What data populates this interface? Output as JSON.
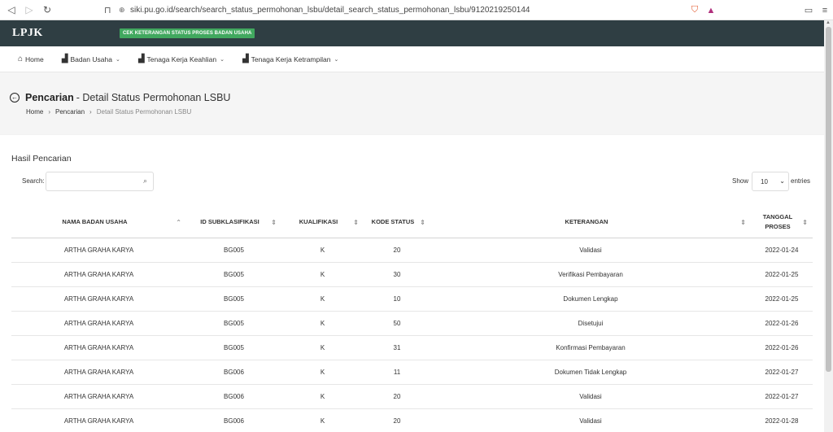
{
  "browser": {
    "url": "siki.pu.go.id/search/search_status_permohonan_lsbu/detail_search_status_permohonan_lsbu/9120219250144"
  },
  "header": {
    "logo": "LPJK",
    "badge": "CEK KETERANGAN STATUS PROSES BADAN USAHA"
  },
  "menu": {
    "items": [
      {
        "label": "Home",
        "icon": "home-icon",
        "dropdown": false
      },
      {
        "label": "Badan Usaha",
        "icon": "building-icon",
        "dropdown": true
      },
      {
        "label": "Tenaga Kerja Keahlian",
        "icon": "building-icon",
        "dropdown": true
      },
      {
        "label": "Tenaga Kerja Ketrampilan",
        "icon": "building-icon",
        "dropdown": true
      }
    ]
  },
  "page": {
    "title_main": "Pencarian",
    "title_sub": "- Detail Status Permohonan LSBU",
    "breadcrumb": [
      "Home",
      "Pencarian",
      "Detail Status Permohonan LSBU"
    ]
  },
  "card": {
    "title": "Hasil Pencarian",
    "search_label": "Search:",
    "search_value": "",
    "show_label": "Show",
    "entries_value": "10",
    "entries_label": "entries"
  },
  "table": {
    "columns": [
      "NAMA BADAN USAHA",
      "ID SUBKLASIFIKASI",
      "KUALIFIKASI",
      "KODE STATUS",
      "KETERANGAN",
      "TANGGAL PROSES"
    ],
    "rows": [
      [
        "ARTHA GRAHA KARYA",
        "BG005",
        "K",
        "20",
        "Validasi",
        "2022-01-24"
      ],
      [
        "ARTHA GRAHA KARYA",
        "BG005",
        "K",
        "30",
        "Verifikasi Pembayaran",
        "2022-01-25"
      ],
      [
        "ARTHA GRAHA KARYA",
        "BG005",
        "K",
        "10",
        "Dokumen Lengkap",
        "2022-01-25"
      ],
      [
        "ARTHA GRAHA KARYA",
        "BG005",
        "K",
        "50",
        "Disetujui",
        "2022-01-26"
      ],
      [
        "ARTHA GRAHA KARYA",
        "BG005",
        "K",
        "31",
        "Konfirmasi Pembayaran",
        "2022-01-26"
      ],
      [
        "ARTHA GRAHA KARYA",
        "BG006",
        "K",
        "11",
        "Dokumen Tidak Lengkap",
        "2022-01-27"
      ],
      [
        "ARTHA GRAHA KARYA",
        "BG006",
        "K",
        "20",
        "Validasi",
        "2022-01-27"
      ],
      [
        "ARTHA GRAHA KARYA",
        "BG006",
        "K",
        "20",
        "Validasi",
        "2022-01-28"
      ]
    ]
  },
  "colors": {
    "header_bg": "#2f3e43",
    "badge_bg": "#41a85f"
  }
}
